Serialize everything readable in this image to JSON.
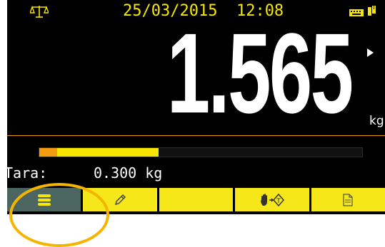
{
  "status": {
    "date": "25/03/2015",
    "time": "12:08",
    "icons": [
      "balance-scale-icon",
      "keyboard-icon",
      "power-plug-icon"
    ]
  },
  "weight": {
    "value": "1.565",
    "unit": "kg"
  },
  "bargraph": {
    "fill_fraction": 0.37,
    "tare_fraction": 0.055
  },
  "tare": {
    "label": "Tara:",
    "value": "0.300 kg"
  },
  "softkeys": [
    {
      "icon": "menu-icon",
      "active": true
    },
    {
      "icon": "pencil-icon",
      "active": false
    },
    {
      "icon": "blank",
      "active": false
    },
    {
      "icon": "hand-tare-icon",
      "active": false
    },
    {
      "icon": "document-icon",
      "active": false
    }
  ],
  "colors": {
    "accent": "#f7e600",
    "background": "#000000",
    "active_key": "#4b6661",
    "divider": "#e8a000",
    "highlight": "#f5b400"
  }
}
